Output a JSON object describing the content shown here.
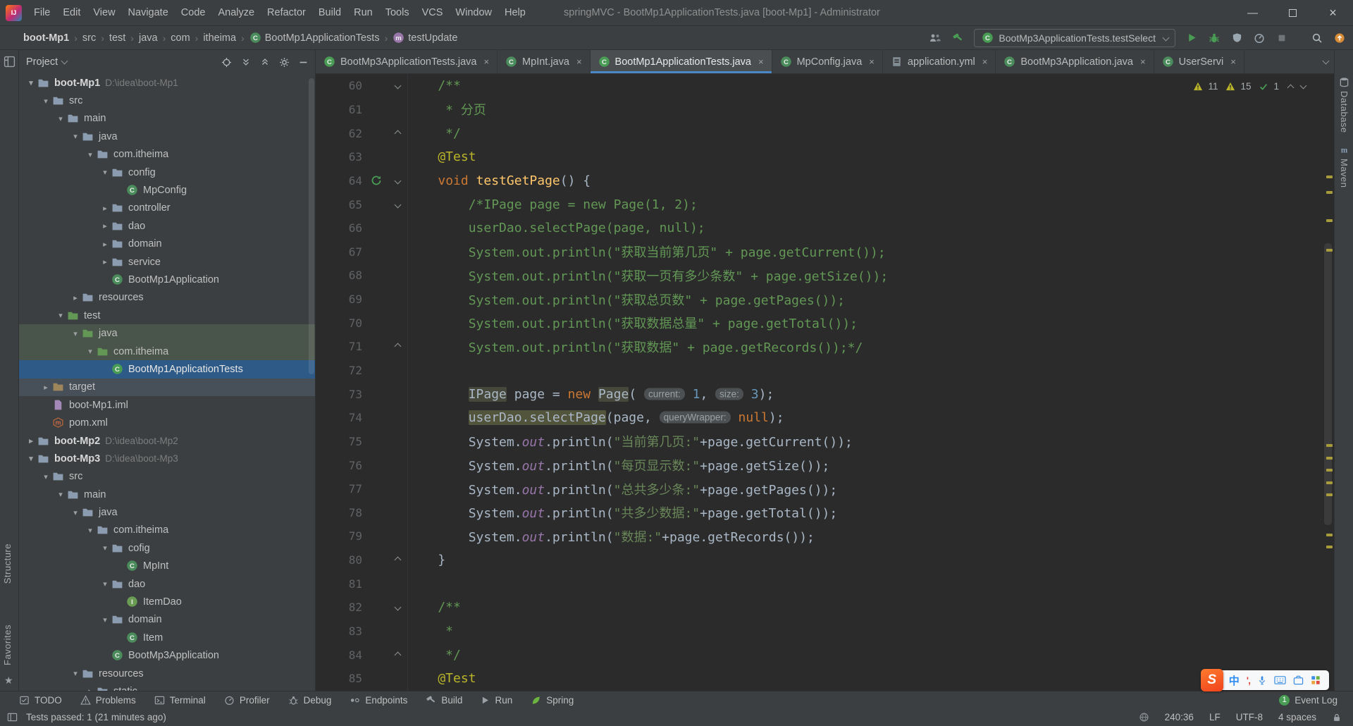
{
  "colors": {
    "panel": "#3c3f41",
    "editor-bg": "#2b2b2b",
    "accent": "#4a88c7",
    "selection": "#2d5a87",
    "test-row": "#49544a",
    "muted-row": "#475059",
    "keyword": "#cc7832",
    "string": "#6a8759",
    "comment": "#629755",
    "number": "#6897bb",
    "annotation": "#bbb529",
    "method": "#ffc66b",
    "field": "#9876aa",
    "plain": "#a9b7c6",
    "line-number": "#606366",
    "green": "#499c54",
    "warning": "#bbb529",
    "orange": "#d98c36"
  },
  "title_bar": {
    "menus": [
      "File",
      "Edit",
      "View",
      "Navigate",
      "Code",
      "Analyze",
      "Refactor",
      "Build",
      "Run",
      "Tools",
      "VCS",
      "Window",
      "Help"
    ],
    "title": "springMVC - BootMp1ApplicationTests.java [boot-Mp1] - Administrator"
  },
  "nav_bar": {
    "separator": "›",
    "breadcrumbs": [
      {
        "label": "boot-Mp1",
        "bold": true
      },
      {
        "label": "src"
      },
      {
        "label": "test"
      },
      {
        "label": "java"
      },
      {
        "label": "com"
      },
      {
        "label": "itheima"
      },
      {
        "label": "BootMp1ApplicationTests",
        "icon": "class"
      },
      {
        "label": "testUpdate",
        "icon": "method"
      }
    ],
    "run_config": {
      "label": "BootMp3ApplicationTests.testSelect",
      "icon": "class"
    }
  },
  "project_panel": {
    "title": "Project",
    "tree": [
      {
        "label": "boot-Mp1",
        "path": "D:\\idea\\boot-Mp1",
        "depth": 0,
        "icon": "folder",
        "arrow": "open",
        "bold": true
      },
      {
        "label": "src",
        "depth": 1,
        "icon": "folder",
        "arrow": "open"
      },
      {
        "label": "main",
        "depth": 2,
        "icon": "folder",
        "arrow": "open"
      },
      {
        "label": "java",
        "depth": 3,
        "icon": "folder",
        "arrow": "open"
      },
      {
        "label": "com.itheima",
        "depth": 4,
        "icon": "folder",
        "arrow": "open"
      },
      {
        "label": "config",
        "depth": 5,
        "icon": "folder",
        "arrow": "open"
      },
      {
        "label": "MpConfig",
        "depth": 6,
        "icon": "class",
        "arrow": "none"
      },
      {
        "label": "controller",
        "depth": 5,
        "icon": "folder",
        "arrow": "closed"
      },
      {
        "label": "dao",
        "depth": 5,
        "icon": "folder",
        "arrow": "closed"
      },
      {
        "label": "domain",
        "depth": 5,
        "icon": "folder",
        "arrow": "closed"
      },
      {
        "label": "service",
        "depth": 5,
        "icon": "folder",
        "arrow": "closed"
      },
      {
        "label": "BootMp1Application",
        "depth": 5,
        "icon": "class",
        "arrow": "none"
      },
      {
        "label": "resources",
        "depth": 3,
        "icon": "folder",
        "arrow": "closed"
      },
      {
        "label": "test",
        "depth": 2,
        "icon": "folder-test",
        "arrow": "open"
      },
      {
        "label": "java",
        "depth": 3,
        "icon": "folder-test",
        "arrow": "open",
        "bg": "test"
      },
      {
        "label": "com.itheima",
        "depth": 4,
        "icon": "folder-test",
        "arrow": "open",
        "bg": "test"
      },
      {
        "label": "BootMp1ApplicationTests",
        "depth": 5,
        "icon": "class-test",
        "arrow": "none",
        "bg": "selected"
      },
      {
        "label": "target",
        "depth": 1,
        "icon": "folder-excluded",
        "arrow": "closed",
        "bg": "muted"
      },
      {
        "label": "boot-Mp1.iml",
        "depth": 1,
        "icon": "iml",
        "arrow": "none"
      },
      {
        "label": "pom.xml",
        "depth": 1,
        "icon": "maven",
        "arrow": "none"
      },
      {
        "label": "boot-Mp2",
        "path": "D:\\idea\\boot-Mp2",
        "depth": 0,
        "icon": "folder",
        "arrow": "closed",
        "bold": true
      },
      {
        "label": "boot-Mp3",
        "path": "D:\\idea\\boot-Mp3",
        "depth": 0,
        "icon": "folder",
        "arrow": "open",
        "bold": true
      },
      {
        "label": "src",
        "depth": 1,
        "icon": "folder",
        "arrow": "open"
      },
      {
        "label": "main",
        "depth": 2,
        "icon": "folder",
        "arrow": "open"
      },
      {
        "label": "java",
        "depth": 3,
        "icon": "folder",
        "arrow": "open"
      },
      {
        "label": "com.itheima",
        "depth": 4,
        "icon": "folder",
        "arrow": "open"
      },
      {
        "label": "cofig",
        "depth": 5,
        "icon": "folder",
        "arrow": "open"
      },
      {
        "label": "MpInt",
        "depth": 6,
        "icon": "class",
        "arrow": "none"
      },
      {
        "label": "dao",
        "depth": 5,
        "icon": "folder",
        "arrow": "open"
      },
      {
        "label": "ItemDao",
        "depth": 6,
        "icon": "interface",
        "arrow": "none"
      },
      {
        "label": "domain",
        "depth": 5,
        "icon": "folder",
        "arrow": "open"
      },
      {
        "label": "Item",
        "depth": 6,
        "icon": "class",
        "arrow": "none"
      },
      {
        "label": "BootMp3Application",
        "depth": 5,
        "icon": "class",
        "arrow": "none"
      },
      {
        "label": "resources",
        "depth": 3,
        "icon": "folder",
        "arrow": "open"
      },
      {
        "label": "static",
        "depth": 4,
        "icon": "folder",
        "arrow": "closed"
      }
    ]
  },
  "tabs": [
    {
      "label": "BootMp3ApplicationTests.java",
      "icon": "class-test"
    },
    {
      "label": "MpInt.java",
      "icon": "class"
    },
    {
      "label": "BootMp1ApplicationTests.java",
      "icon": "class-test",
      "active": true
    },
    {
      "label": "MpConfig.java",
      "icon": "class"
    },
    {
      "label": "application.yml",
      "icon": "yml"
    },
    {
      "label": "BootMp3Application.java",
      "icon": "class"
    },
    {
      "label": "UserServi",
      "icon": "class"
    }
  ],
  "inspections": {
    "warnings_weak": "11",
    "warnings": "15",
    "passed": "1"
  },
  "editor": {
    "first_line": 60,
    "scroll_marks": [
      0.165,
      0.19,
      0.235,
      0.283,
      0.6,
      0.62,
      0.64,
      0.66,
      0.68,
      0.745,
      0.765
    ],
    "lines": [
      {
        "num": "60",
        "fold": "start",
        "segs": [
          [
            "tc",
            "    /**"
          ]
        ]
      },
      {
        "num": "61",
        "segs": [
          [
            "tc",
            "     * 分页"
          ]
        ]
      },
      {
        "num": "62",
        "fold": "end",
        "segs": [
          [
            "tc",
            "     */"
          ]
        ]
      },
      {
        "num": "63",
        "segs": [
          [
            "ta",
            "    @Test"
          ]
        ]
      },
      {
        "num": "64",
        "gutter": "run",
        "fold": "start",
        "segs": [
          [
            "tp",
            "    "
          ],
          [
            "tk",
            "void"
          ],
          [
            "tp",
            " "
          ],
          [
            "tm",
            "testGetPage"
          ],
          [
            "tp",
            "() {"
          ]
        ]
      },
      {
        "num": "65",
        "fold": "start",
        "segs": [
          [
            "tp",
            "        "
          ],
          [
            "tc",
            "/*IPage page = new Page(1, 2);"
          ]
        ]
      },
      {
        "num": "66",
        "segs": [
          [
            "tc",
            "        userDao.selectPage(page, null);"
          ]
        ]
      },
      {
        "num": "67",
        "segs": [
          [
            "tc",
            "        System.out.println(\"获取当前第几页\" + page.getCurrent());"
          ]
        ]
      },
      {
        "num": "68",
        "segs": [
          [
            "tc",
            "        System.out.println(\"获取一页有多少条数\" + page.getSize());"
          ]
        ]
      },
      {
        "num": "69",
        "segs": [
          [
            "tc",
            "        System.out.println(\"获取总页数\" + page.getPages());"
          ]
        ]
      },
      {
        "num": "70",
        "segs": [
          [
            "tc",
            "        System.out.println(\"获取数据总量\" + page.getTotal());"
          ]
        ]
      },
      {
        "num": "71",
        "fold": "end",
        "segs": [
          [
            "tc",
            "        System.out.println(\"获取数据\" + page.getRecords());*/"
          ]
        ]
      },
      {
        "num": "72",
        "segs": []
      },
      {
        "num": "73",
        "segs": [
          [
            "tp",
            "        "
          ],
          [
            "hl1",
            "IPage"
          ],
          [
            "tp",
            " page = "
          ],
          [
            "tk",
            "new"
          ],
          [
            "tp",
            " "
          ],
          [
            "hl1",
            "Page"
          ],
          [
            "tp",
            "( "
          ],
          [
            "th",
            "current:"
          ],
          [
            "tp",
            " "
          ],
          [
            "tn",
            "1"
          ],
          [
            "tp",
            ", "
          ],
          [
            "th",
            "size:"
          ],
          [
            "tp",
            " "
          ],
          [
            "tn",
            "3"
          ],
          [
            "tp",
            ");"
          ]
        ]
      },
      {
        "num": "74",
        "segs": [
          [
            "tp",
            "        "
          ],
          [
            "hl2",
            "userDao.selectPage"
          ],
          [
            "tp",
            "(page, "
          ],
          [
            "th",
            "queryWrapper:"
          ],
          [
            "tp",
            " "
          ],
          [
            "tk",
            "null"
          ],
          [
            "tp",
            ");"
          ]
        ]
      },
      {
        "num": "75",
        "segs": [
          [
            "tp",
            "        System."
          ],
          [
            "tf",
            "out"
          ],
          [
            "tp",
            ".println("
          ],
          [
            "ts",
            "\"当前第几页:\""
          ],
          [
            "tp",
            "+page.getCurrent());"
          ]
        ]
      },
      {
        "num": "76",
        "segs": [
          [
            "tp",
            "        System."
          ],
          [
            "tf",
            "out"
          ],
          [
            "tp",
            ".println("
          ],
          [
            "ts",
            "\"每页显示数:\""
          ],
          [
            "tp",
            "+page.getSize());"
          ]
        ]
      },
      {
        "num": "77",
        "segs": [
          [
            "tp",
            "        System."
          ],
          [
            "tf",
            "out"
          ],
          [
            "tp",
            ".println("
          ],
          [
            "ts",
            "\"总共多少条:\""
          ],
          [
            "tp",
            "+page.getPages());"
          ]
        ]
      },
      {
        "num": "78",
        "segs": [
          [
            "tp",
            "        System."
          ],
          [
            "tf",
            "out"
          ],
          [
            "tp",
            ".println("
          ],
          [
            "ts",
            "\"共多少数据:\""
          ],
          [
            "tp",
            "+page.getTotal());"
          ]
        ]
      },
      {
        "num": "79",
        "segs": [
          [
            "tp",
            "        System."
          ],
          [
            "tf",
            "out"
          ],
          [
            "tp",
            ".println("
          ],
          [
            "ts",
            "\"数据:\""
          ],
          [
            "tp",
            "+page.getRecords());"
          ]
        ]
      },
      {
        "num": "80",
        "fold": "end",
        "segs": [
          [
            "tp",
            "    }"
          ]
        ]
      },
      {
        "num": "81",
        "segs": []
      },
      {
        "num": "82",
        "fold": "start",
        "segs": [
          [
            "tc",
            "    /**"
          ]
        ]
      },
      {
        "num": "83",
        "segs": [
          [
            "tc",
            "     *"
          ]
        ]
      },
      {
        "num": "84",
        "fold": "end",
        "segs": [
          [
            "tc",
            "     */"
          ]
        ]
      },
      {
        "num": "85",
        "segs": [
          [
            "ta",
            "    @Test"
          ]
        ]
      }
    ]
  },
  "tool_windows": {
    "left_bottom": [
      "Structure",
      "Favorites"
    ],
    "right": [
      "Database",
      "Maven"
    ],
    "bottom": [
      {
        "label": "TODO",
        "icon": "todo"
      },
      {
        "label": "Problems",
        "icon": "problems"
      },
      {
        "label": "Terminal",
        "icon": "terminal"
      },
      {
        "label": "Profiler",
        "icon": "profiler"
      },
      {
        "label": "Debug",
        "icon": "debug"
      },
      {
        "label": "Endpoints",
        "icon": "endpoints"
      },
      {
        "label": "Build",
        "icon": "build"
      },
      {
        "label": "Run",
        "icon": "run"
      },
      {
        "label": "Spring",
        "icon": "spring"
      }
    ],
    "event_log": {
      "label": "Event Log",
      "badge": "1"
    }
  },
  "status_bar": {
    "message": "Tests passed: 1 (21 minutes ago)",
    "position": "240:36",
    "line_sep": "LF",
    "encoding": "UTF-8",
    "indent": "4 spaces"
  },
  "ime_bar": {
    "cn": "中",
    "punct": "',"
  }
}
